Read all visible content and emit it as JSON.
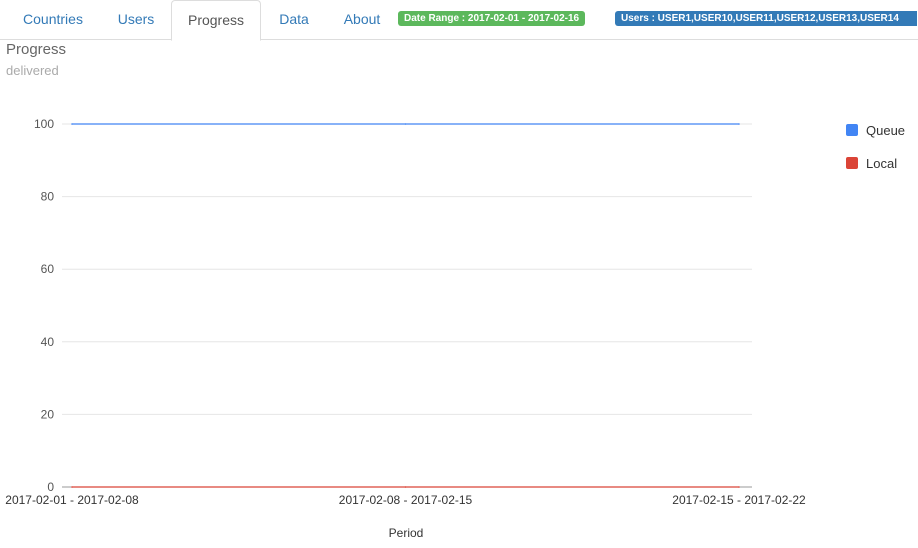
{
  "tabs": [
    {
      "label": "Countries",
      "active": false
    },
    {
      "label": "Users",
      "active": false
    },
    {
      "label": "Progress",
      "active": true
    },
    {
      "label": "Data",
      "active": false
    },
    {
      "label": "About",
      "active": false
    }
  ],
  "filters": {
    "date_range": "Date Range : 2017-02-01 - 2017-02-16",
    "users": "Users : USER1,USER10,USER11,USER12,USER13,USER14"
  },
  "page": {
    "title": "Progress",
    "subtitle": "delivered"
  },
  "colors": {
    "accent": "#337ab7",
    "range_badge": "#5cb85c",
    "queue": "#4285f4",
    "local": "#db4437"
  },
  "chart_data": {
    "type": "line",
    "categories": [
      "2017-02-01 - 2017-02-08",
      "2017-02-08 - 2017-02-15",
      "2017-02-15 - 2017-02-22"
    ],
    "series": [
      {
        "name": "Queue",
        "values": [
          100,
          100,
          100
        ],
        "color": "#4285f4"
      },
      {
        "name": "Local",
        "values": [
          0,
          0,
          0
        ],
        "color": "#db4437"
      }
    ],
    "yticks": [
      0,
      20,
      40,
      60,
      80,
      100
    ],
    "ylim": [
      0,
      100
    ],
    "xlabel": "Period",
    "ylabel": "",
    "grid": true,
    "legend": "right"
  }
}
